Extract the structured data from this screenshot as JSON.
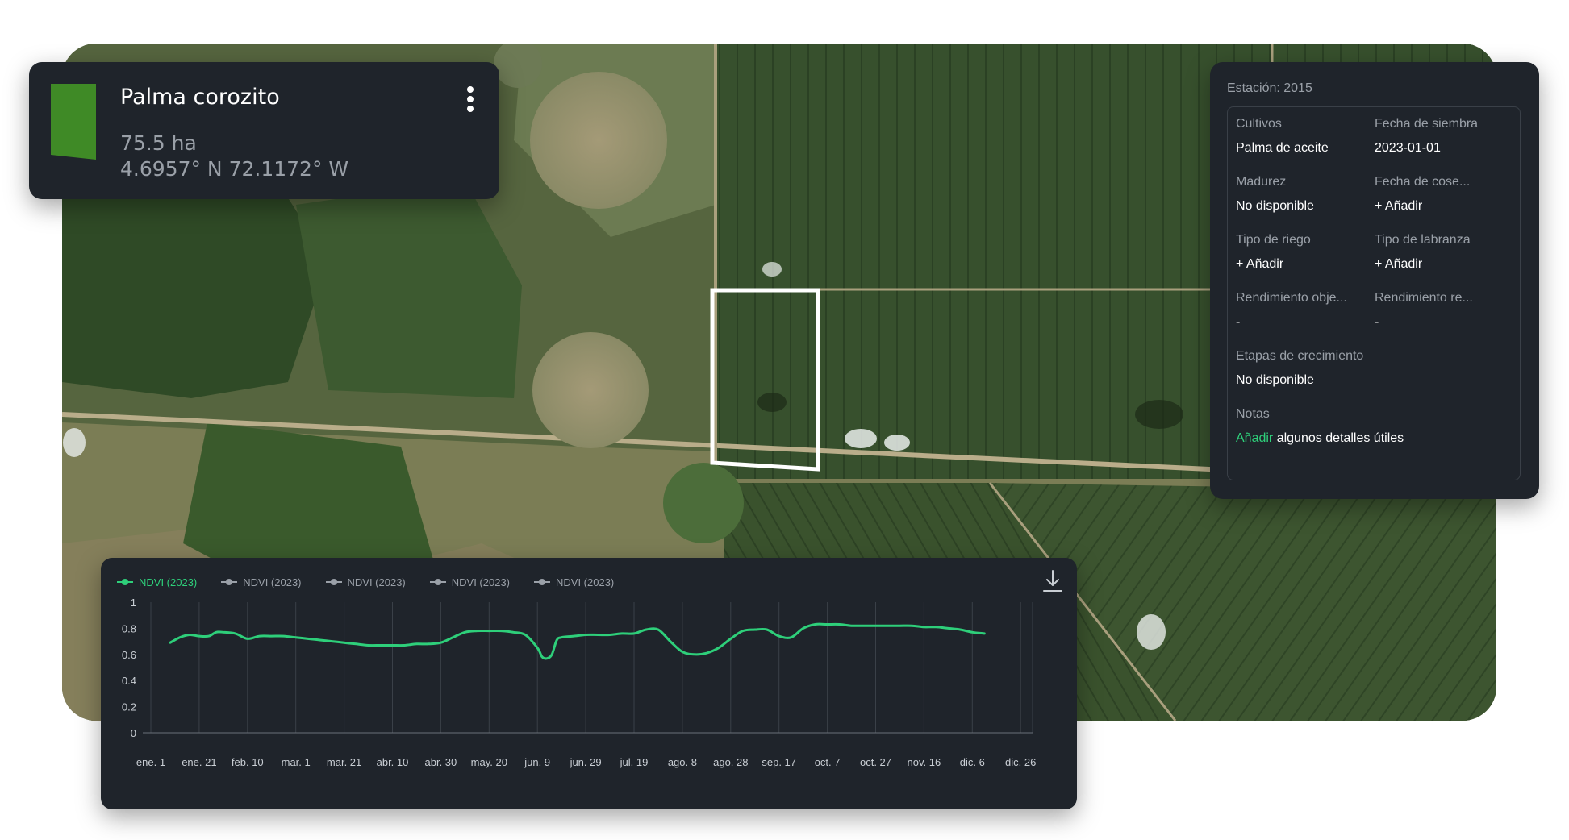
{
  "field": {
    "name": "Palma corozito",
    "area": "75.5 ha",
    "coords": "4.6957° N 72.1172° W",
    "color": "#3f8a26",
    "menu_icon": "more-vertical-icon"
  },
  "info": {
    "season": "Estación: 2015",
    "crop_label": "Cultivos",
    "crop_value": "Palma de aceite",
    "sowing_label": "Fecha de siembra",
    "sowing_value": "2023-01-01",
    "maturity_label": "Madurez",
    "maturity_value": "No disponible",
    "harvest_label": "Fecha de cose...",
    "irrigation_label": "Tipo de riego",
    "tillage_label": "Tipo de labranza",
    "add_label": "+ Añadir",
    "target_yield_label": "Rendimiento obje...",
    "target_yield_value": "-",
    "actual_yield_label": "Rendimiento re...",
    "actual_yield_value": "-",
    "growth_label": "Etapas de crecimiento",
    "growth_value": "No disponible",
    "notes_label": "Notas",
    "notes_link": "Añadir",
    "notes_text": "algunos detalles útiles"
  },
  "colors": {
    "accent": "#2ecf7a",
    "panel": "#1f242b",
    "muted": "#9aa0a8"
  },
  "chart_data": {
    "type": "line",
    "legend": [
      "NDVI (2023)",
      "NDVI (2023)",
      "NDVI (2023)",
      "NDVI (2023)",
      "NDVI (2023)"
    ],
    "active_series": 0,
    "y_ticks": [
      "1",
      "0.8",
      "0.6",
      "0.4",
      "0.2",
      "0"
    ],
    "ylim": [
      0,
      1
    ],
    "categories": [
      "ene. 1",
      "ene. 21",
      "feb. 10",
      "mar. 1",
      "mar. 21",
      "abr. 10",
      "abr. 30",
      "may. 20",
      "jun. 9",
      "jun. 29",
      "jul. 19",
      "ago. 8",
      "ago. 28",
      "sep. 17",
      "oct. 7",
      "oct. 27",
      "nov. 16",
      "dic. 6",
      "dic. 26"
    ],
    "series": [
      {
        "name": "NDVI (2023)",
        "x": [
          8,
          12,
          16,
          20,
          24,
          27,
          30,
          35,
          40,
          45,
          50,
          55,
          60,
          65,
          70,
          75,
          80,
          85,
          90,
          95,
          100,
          105,
          110,
          115,
          120,
          125,
          130,
          135,
          140,
          145,
          150,
          155,
          160,
          162,
          164,
          166,
          168,
          170,
          175,
          180,
          185,
          190,
          195,
          200,
          205,
          210,
          215,
          220,
          225,
          230,
          235,
          240,
          245,
          250,
          255,
          260,
          265,
          270,
          275,
          280,
          285,
          290,
          295,
          300,
          305,
          310,
          315,
          320,
          325,
          330,
          335,
          340,
          345
        ],
        "y": [
          0.69,
          0.73,
          0.75,
          0.74,
          0.74,
          0.77,
          0.77,
          0.76,
          0.72,
          0.74,
          0.74,
          0.74,
          0.73,
          0.72,
          0.71,
          0.7,
          0.69,
          0.68,
          0.67,
          0.67,
          0.67,
          0.67,
          0.68,
          0.68,
          0.69,
          0.73,
          0.77,
          0.78,
          0.78,
          0.78,
          0.77,
          0.75,
          0.65,
          0.58,
          0.57,
          0.6,
          0.71,
          0.73,
          0.74,
          0.75,
          0.75,
          0.75,
          0.76,
          0.76,
          0.79,
          0.79,
          0.7,
          0.62,
          0.6,
          0.61,
          0.65,
          0.72,
          0.78,
          0.79,
          0.79,
          0.74,
          0.73,
          0.8,
          0.83,
          0.83,
          0.83,
          0.82,
          0.82,
          0.82,
          0.82,
          0.82,
          0.82,
          0.81,
          0.81,
          0.8,
          0.79,
          0.77,
          0.76
        ]
      }
    ]
  }
}
